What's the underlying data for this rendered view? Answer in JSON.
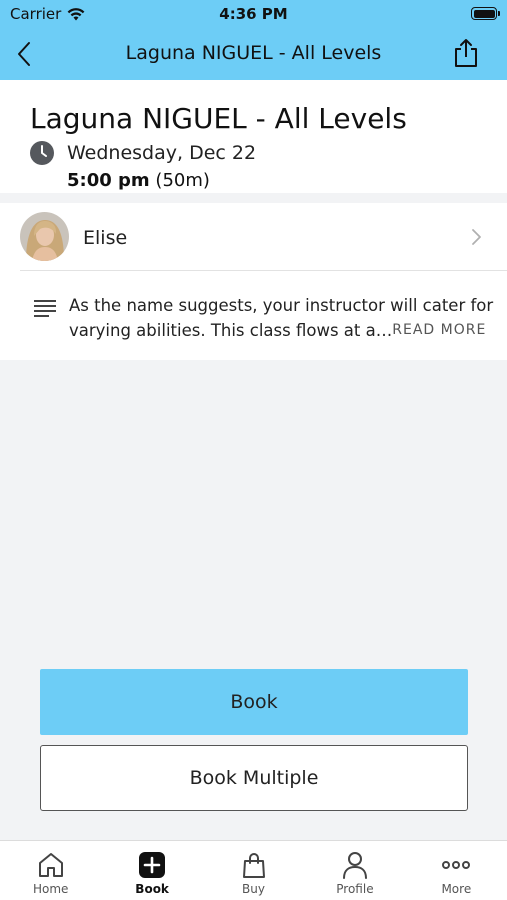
{
  "status_bar": {
    "carrier": "Carrier",
    "time": "4:36 PM"
  },
  "nav": {
    "title": "Laguna NIGUEL - All Levels"
  },
  "class_info": {
    "title": "Laguna NIGUEL - All Levels",
    "date": "Wednesday, Dec 22",
    "time": "5:00 pm",
    "duration": "(50m)"
  },
  "instructor": {
    "name": "Elise"
  },
  "description": {
    "line1": "As the name suggests, your instructor will cater for",
    "line2": "varying abilities. This class flows at a…",
    "read_more": "READ MORE"
  },
  "actions": {
    "book_label": "Book",
    "book_multiple_label": "Book Multiple"
  },
  "tabs": [
    {
      "label": "Home",
      "icon": "home-icon"
    },
    {
      "label": "Book",
      "icon": "plus-square-icon",
      "active": true
    },
    {
      "label": "Buy",
      "icon": "shopping-bag-icon"
    },
    {
      "label": "Profile",
      "icon": "person-icon"
    },
    {
      "label": "More",
      "icon": "more-dots-icon"
    }
  ],
  "colors": {
    "accent": "#6dcdf6",
    "background": "#f2f3f5"
  }
}
